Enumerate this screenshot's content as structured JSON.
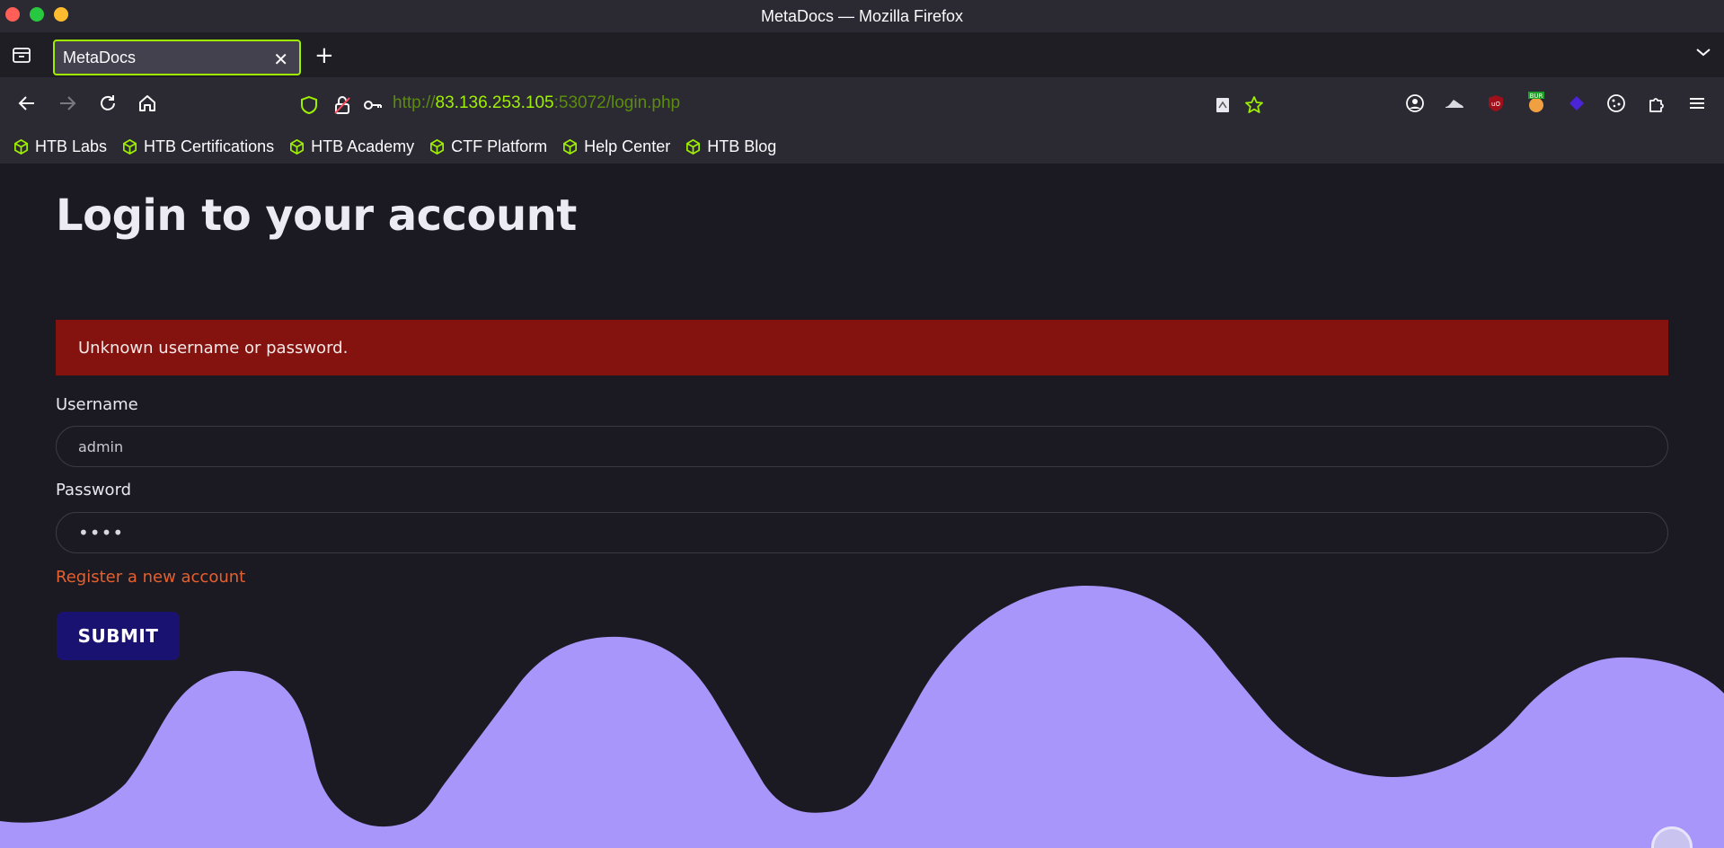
{
  "window": {
    "title": "MetaDocs — Mozilla Firefox"
  },
  "tabs": [
    {
      "label": "MetaDocs",
      "active": true
    }
  ],
  "address": {
    "scheme": "http://",
    "host": "83.136.253.105",
    "rest": ":53072/login.php"
  },
  "bookmarks": [
    {
      "label": "HTB Labs"
    },
    {
      "label": "HTB Certifications"
    },
    {
      "label": "HTB Academy"
    },
    {
      "label": "CTF Platform"
    },
    {
      "label": "Help Center"
    },
    {
      "label": "HTB Blog"
    }
  ],
  "page": {
    "heading": "Login to your account",
    "alert": "Unknown username or password.",
    "username_label": "Username",
    "username_value": "admin",
    "password_label": "Password",
    "password_value": "••••",
    "register_link": "Register a new account",
    "submit_label": "SUBMIT"
  },
  "colors": {
    "accent": "#9fef00",
    "alert_bg": "#84130f",
    "wave": "#a896fb",
    "submit_bg": "#1a1271",
    "link": "#e5602e"
  }
}
